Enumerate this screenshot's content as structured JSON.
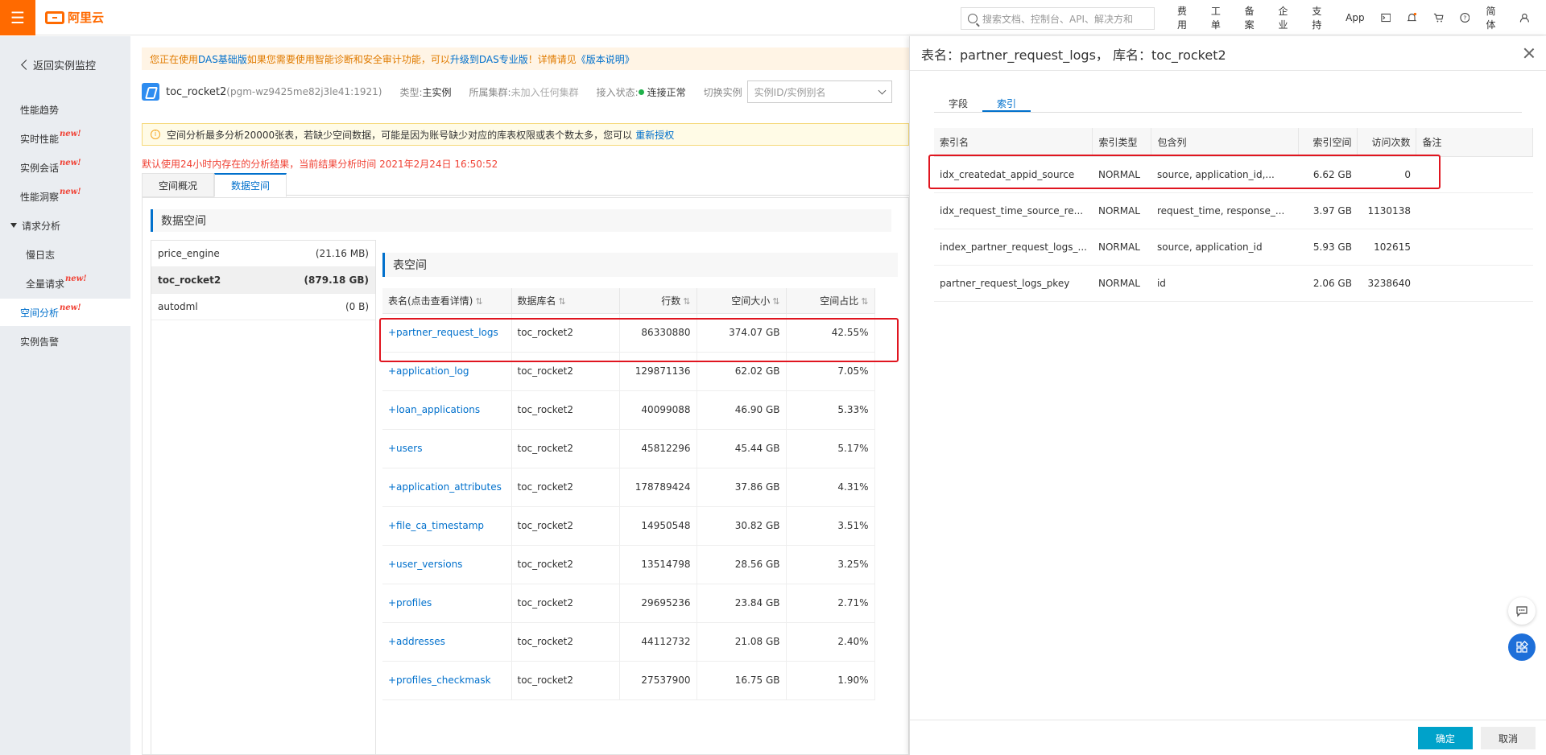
{
  "header": {
    "logo_text": "阿里云",
    "search_placeholder": "搜索文档、控制台、API、解决方和",
    "nav": [
      "费用",
      "工单",
      "备案",
      "企业",
      "支持",
      "App"
    ],
    "lang": "简体",
    "accent": "#ff6a00"
  },
  "sidebar": {
    "back_label": "返回实例监控",
    "new_badge": "new!",
    "items": [
      {
        "label": "性能趋势",
        "new": false
      },
      {
        "label": "实时性能",
        "new": true
      },
      {
        "label": "实例会话",
        "new": true
      },
      {
        "label": "性能洞察",
        "new": true
      },
      {
        "label": "请求分析",
        "new": false
      },
      {
        "label": "慢日志",
        "new": false
      },
      {
        "label": "全量请求",
        "new": true
      },
      {
        "label": "空间分析",
        "new": true
      },
      {
        "label": "实例告警",
        "new": false
      }
    ]
  },
  "notice": {
    "prefix": "您正在使用",
    "link1": "DAS基础版",
    "middle": "如果您需要使用智能诊断和安全审计功能，可以",
    "link2": "升级到DAS专业版",
    "middle2": "！详情请见",
    "link3": "《版本说明》"
  },
  "instance": {
    "name": "toc_rocket2",
    "id": "(pgm-wz9425me82j3le41:1921)",
    "type_label": "类型:",
    "type_value": "主实例",
    "cluster_label": "所属集群:",
    "cluster_value": "未加入任何集群",
    "status_label": "接入状态:",
    "status_value": "连接正常",
    "switch_label": "切换实例",
    "switch_placeholder": "实例ID/实例别名"
  },
  "info_bar": {
    "text": "空间分析最多分析20000张表，若缺少空间数据，可能是因为账号缺少对应的库表权限或表个数太多，您可以",
    "link": "重新授权"
  },
  "analysis_note": "默认使用24小时内存在的分析结果，当前结果分析时间 2021年2月24日 16:50:52",
  "tabs": [
    "空间概况",
    "数据空间"
  ],
  "data_space": {
    "title": "数据空间",
    "databases": [
      {
        "name": "price_engine",
        "size": "(21.16 MB)"
      },
      {
        "name": "toc_rocket2",
        "size": "(879.18 GB)"
      },
      {
        "name": "autodml",
        "size": "(0 B)"
      }
    ],
    "table_space_title": "表空间",
    "columns": [
      "表名(点击查看详情)",
      "数据库名",
      "行数",
      "空间大小",
      "空间占比"
    ],
    "rows": [
      [
        "+partner_request_logs",
        "toc_rocket2",
        "86330880",
        "374.07 GB",
        "42.55%"
      ],
      [
        "+application_log",
        "toc_rocket2",
        "129871136",
        "62.02 GB",
        "7.05%"
      ],
      [
        "+loan_applications",
        "toc_rocket2",
        "40099088",
        "46.90 GB",
        "5.33%"
      ],
      [
        "+users",
        "toc_rocket2",
        "45812296",
        "45.44 GB",
        "5.17%"
      ],
      [
        "+application_attributes",
        "toc_rocket2",
        "178789424",
        "37.86 GB",
        "4.31%"
      ],
      [
        "+file_ca_timestamp",
        "toc_rocket2",
        "14950548",
        "30.82 GB",
        "3.51%"
      ],
      [
        "+user_versions",
        "toc_rocket2",
        "13514798",
        "28.56 GB",
        "3.25%"
      ],
      [
        "+profiles",
        "toc_rocket2",
        "29695236",
        "23.84 GB",
        "2.71%"
      ],
      [
        "+addresses",
        "toc_rocket2",
        "44112732",
        "21.08 GB",
        "2.40%"
      ],
      [
        "+profiles_checkmask",
        "toc_rocket2",
        "27537900",
        "16.75 GB",
        "1.90%"
      ]
    ]
  },
  "drawer": {
    "title": "表名：partner_request_logs， 库名：toc_rocket2",
    "tabs": [
      "字段",
      "索引"
    ],
    "columns": [
      "索引名",
      "索引类型",
      "包含列",
      "索引空间",
      "访问次数",
      "备注"
    ],
    "rows": [
      [
        "idx_createdat_appid_source",
        "NORMAL",
        "source, application_id,...",
        "6.62 GB",
        "0",
        ""
      ],
      [
        "idx_request_time_source_re...",
        "NORMAL",
        "request_time, response_...",
        "3.97 GB",
        "1130138",
        ""
      ],
      [
        "index_partner_request_logs_...",
        "NORMAL",
        "source, application_id",
        "5.93 GB",
        "102615",
        ""
      ],
      [
        "partner_request_logs_pkey",
        "NORMAL",
        "id",
        "2.06 GB",
        "3238640",
        ""
      ]
    ],
    "ok": "确定",
    "cancel": "取消"
  }
}
